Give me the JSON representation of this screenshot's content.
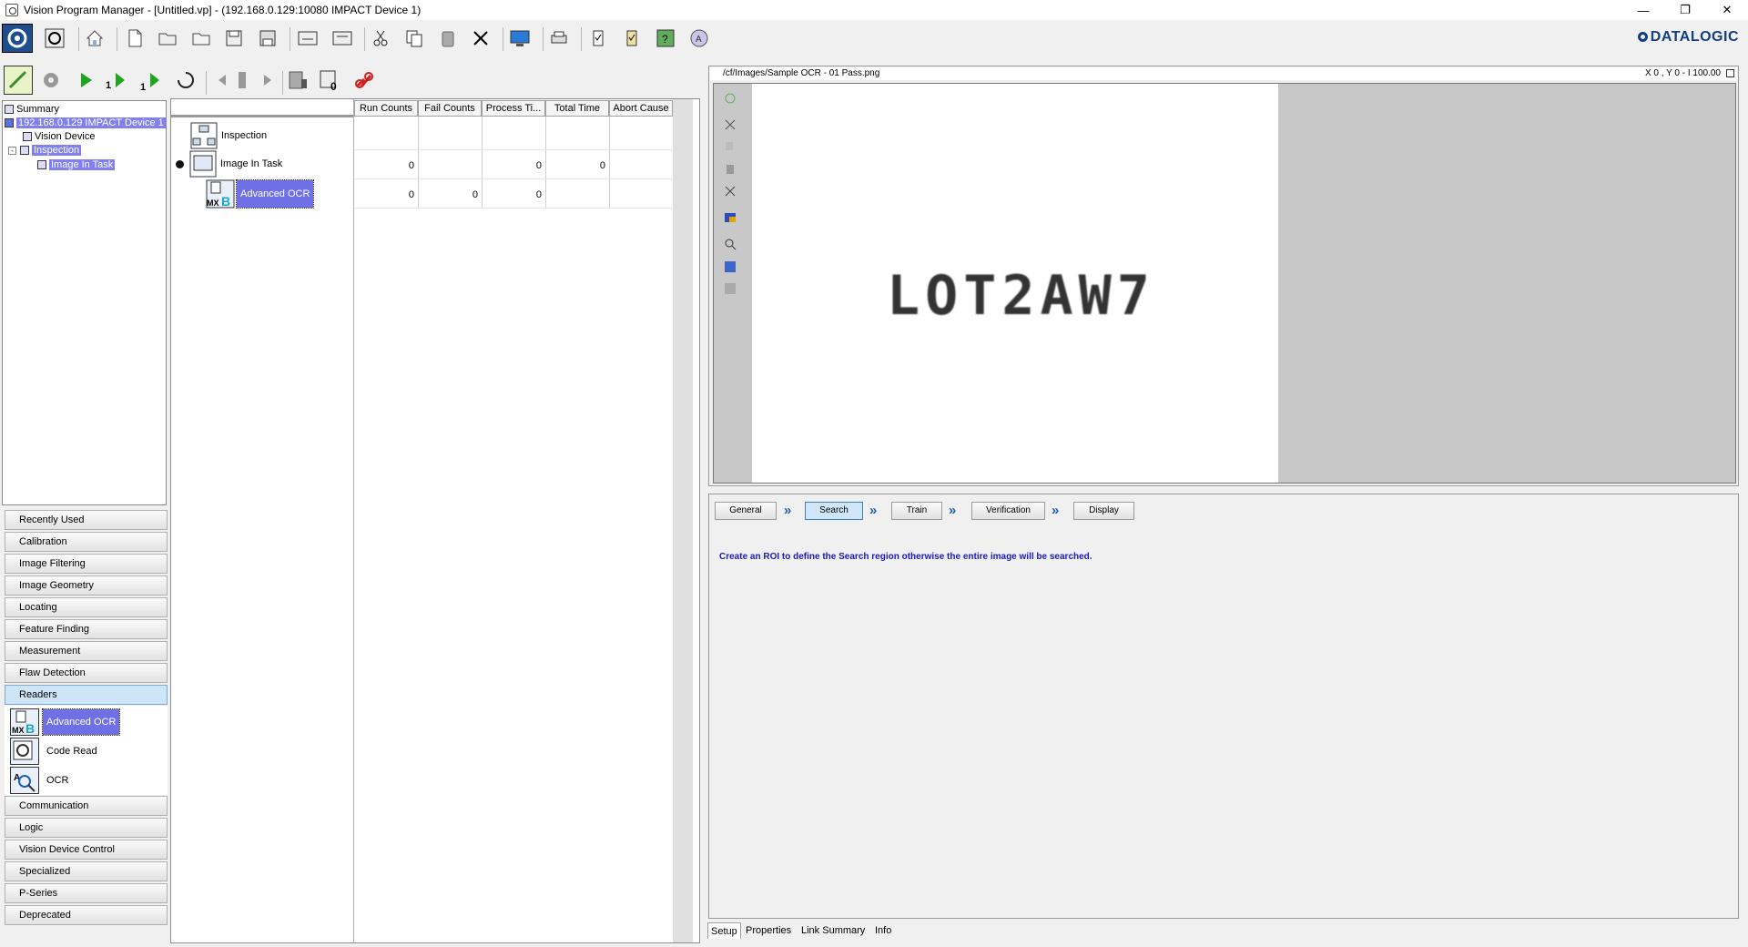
{
  "window": {
    "title": "Vision Program Manager - [Untitled.vp] - (192.168.0.129:10080 IMPACT Device 1)",
    "controls": [
      "minimize",
      "restore",
      "close"
    ]
  },
  "brand": "DATALOGIC",
  "nav_tree": {
    "summary": "Summary",
    "device": "192.168.0.129 IMPACT Device 1",
    "vision_device": "Vision Device",
    "inspection": "Inspection",
    "image_in_task": "Image In Task"
  },
  "categories": {
    "recently_used": "Recently Used",
    "calibration": "Calibration",
    "image_filtering": "Image Filtering",
    "image_geometry": "Image Geometry",
    "locating": "Locating",
    "feature_finding": "Feature Finding",
    "measurement": "Measurement",
    "flaw_detection": "Flaw Detection",
    "readers": "Readers",
    "communication": "Communication",
    "logic": "Logic",
    "vision_device_control": "Vision Device Control",
    "specialized": "Specialized",
    "p_series": "P-Series",
    "deprecated": "Deprecated"
  },
  "readers_tools": {
    "advanced_ocr": "Advanced OCR",
    "code_read": "Code Read",
    "ocr": "OCR"
  },
  "task_grid": {
    "columns": [
      "Run Counts",
      "Fail Counts",
      "Process Ti...",
      "Total Time",
      "Abort Cause"
    ],
    "rows": [
      {
        "name": "Inspection",
        "cells": [
          "",
          "",
          "",
          "",
          ""
        ]
      },
      {
        "name": "Image In Task",
        "cells": [
          "0",
          "",
          "0",
          "0",
          ""
        ]
      },
      {
        "name": "Advanced OCR",
        "cells": [
          "0",
          "0",
          "0",
          "",
          ""
        ]
      }
    ]
  },
  "image_view": {
    "path": "/cf/Images/Sample OCR - 01 Pass.png",
    "status": "X 0 ,  Y 0  -  I 100.00",
    "ocr_text": "LOT2AW7"
  },
  "wizard": {
    "steps": [
      "General",
      "Search",
      "Train",
      "Verification",
      "Display"
    ],
    "active_step": "Search",
    "message": "Create an ROI to define the Search region otherwise the entire image will be searched."
  },
  "bottom_tabs": [
    "Setup",
    "Properties",
    "Link Summary",
    "Info"
  ],
  "colors": {
    "selection": "#8080f0",
    "message": "#1b1bb4",
    "brand": "#123f80",
    "active_step": "#cfe6fa"
  }
}
